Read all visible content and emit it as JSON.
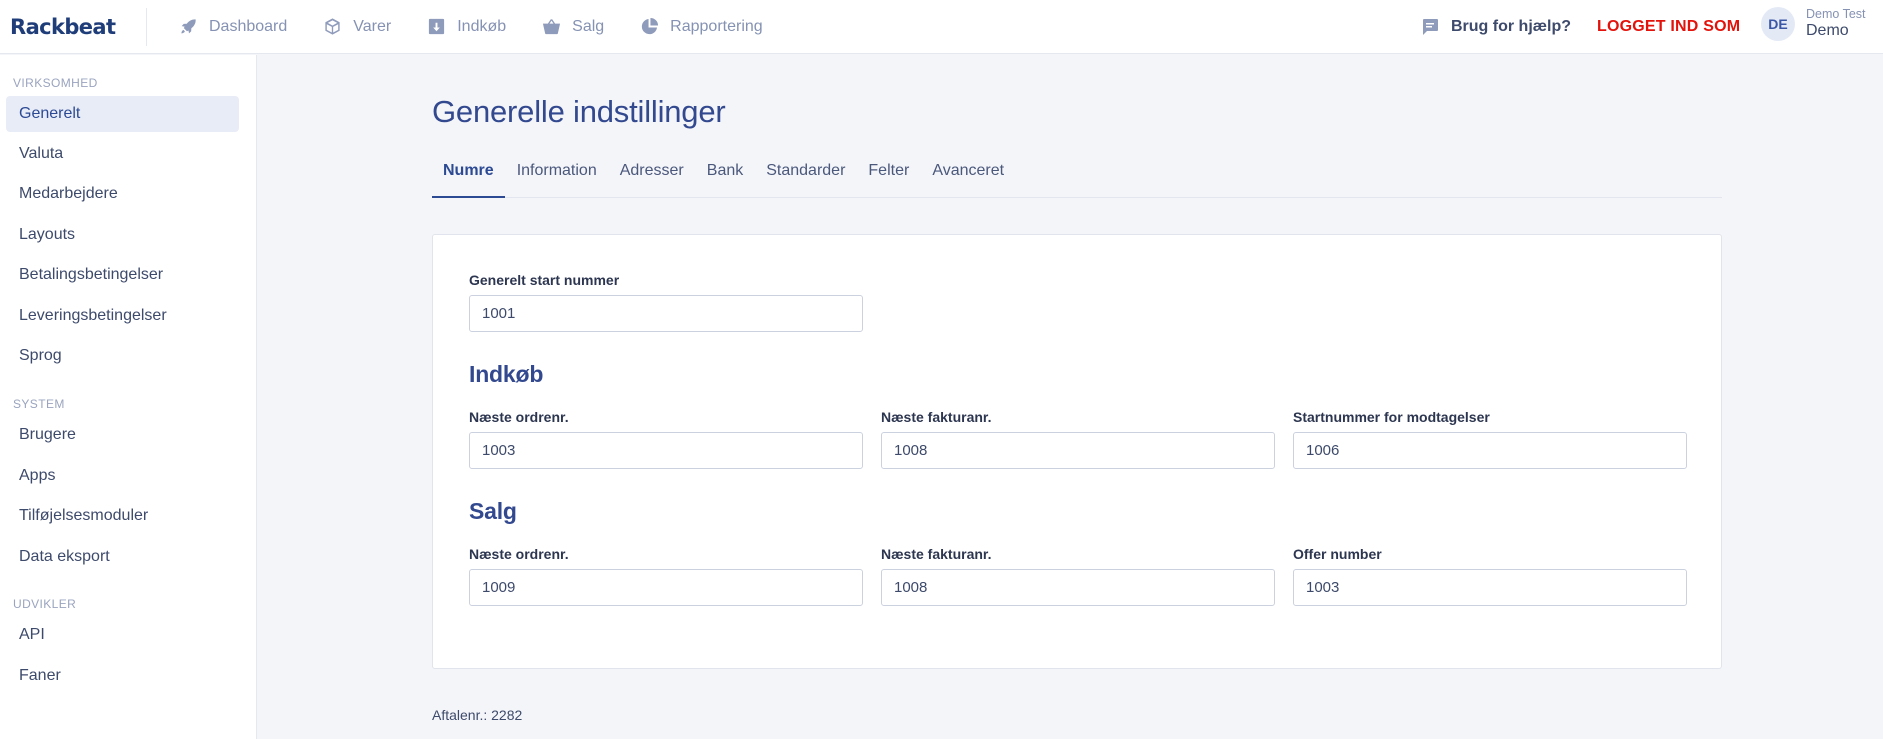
{
  "app": {
    "logo": "Rackbeat"
  },
  "topnav": {
    "items": [
      {
        "label": "Dashboard",
        "icon": "rocket-icon"
      },
      {
        "label": "Varer",
        "icon": "box-icon"
      },
      {
        "label": "Indkøb",
        "icon": "download-icon"
      },
      {
        "label": "Salg",
        "icon": "basket-icon"
      },
      {
        "label": "Rapportering",
        "icon": "pie-chart-icon"
      }
    ],
    "help_label": "Brug for hjælp?",
    "logged_in_as_label": "LOGGET IND SOM",
    "logged_in_color": "#e3120b",
    "user": {
      "initials": "DE",
      "company": "Demo Test",
      "name": "Demo"
    }
  },
  "sidebar": {
    "sections": [
      {
        "title": "VIRKSOMHED",
        "items": [
          "Generelt",
          "Valuta",
          "Medarbejdere",
          "Layouts",
          "Betalingsbetingelser",
          "Leveringsbetingelser",
          "Sprog"
        ]
      },
      {
        "title": "SYSTEM",
        "items": [
          "Brugere",
          "Apps",
          "Tilføjelsesmoduler",
          "Data eksport"
        ]
      },
      {
        "title": "UDVIKLER",
        "items": [
          "API",
          "Faner"
        ]
      }
    ],
    "active_item": "Generelt"
  },
  "main": {
    "title": "Generelle indstillinger",
    "tabs": [
      "Numre",
      "Information",
      "Adresser",
      "Bank",
      "Standarder",
      "Felter",
      "Avanceret"
    ],
    "active_tab": "Numre",
    "general": {
      "label": "Generelt start nummer",
      "value": "1001"
    },
    "purchase": {
      "heading": "Indkøb",
      "fields": [
        {
          "label": "Næste ordrenr.",
          "value": "1003"
        },
        {
          "label": "Næste fakturanr.",
          "value": "1008"
        },
        {
          "label": "Startnummer for modtagelser",
          "value": "1006"
        }
      ]
    },
    "sales": {
      "heading": "Salg",
      "fields": [
        {
          "label": "Næste ordrenr.",
          "value": "1009"
        },
        {
          "label": "Næste fakturanr.",
          "value": "1008"
        },
        {
          "label": "Offer number",
          "value": "1003"
        }
      ]
    },
    "footer_note": "Aftalenr.: 2282"
  }
}
